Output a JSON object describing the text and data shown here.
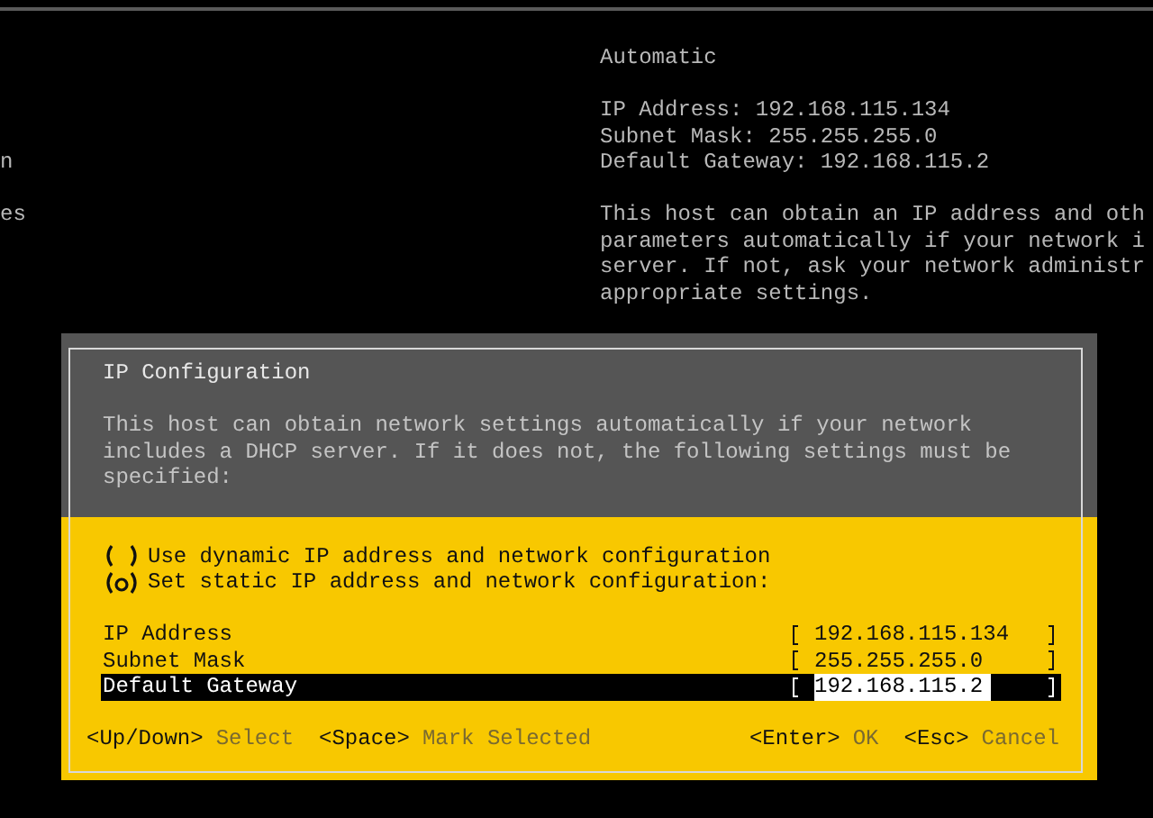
{
  "background": {
    "left_fragments": [
      "n",
      "es"
    ],
    "mode": "Automatic",
    "details": [
      "IP Address: 192.168.115.134",
      "Subnet Mask: 255.255.255.0",
      "Default Gateway: 192.168.115.2"
    ],
    "help_lines": [
      "This host can obtain an IP address and oth",
      "parameters automatically if your network i",
      "server. If not, ask your network administr",
      "appropriate settings."
    ]
  },
  "dialog": {
    "title": "IP Configuration",
    "description": "This host can obtain network settings automatically if your network includes a DHCP server. If it does not, the following settings must be specified:",
    "options": [
      {
        "label": "Use dynamic IP address and network configuration",
        "selected": false
      },
      {
        "label": "Set static IP address and network configuration:",
        "selected": true
      }
    ],
    "fields": [
      {
        "label": "IP Address",
        "value": "192.168.115.134",
        "selected": false
      },
      {
        "label": "Subnet Mask",
        "value": "255.255.255.0",
        "selected": false
      },
      {
        "label": "Default Gateway",
        "value": "192.168.115.2",
        "selected": true
      }
    ],
    "hints_left": [
      {
        "key": "<Up/Down>",
        "action": "Select"
      },
      {
        "key": "<Space>",
        "action": "Mark Selected"
      }
    ],
    "hints_right": [
      {
        "key": "<Enter>",
        "action": "OK"
      },
      {
        "key": "<Esc>",
        "action": "Cancel"
      }
    ]
  }
}
